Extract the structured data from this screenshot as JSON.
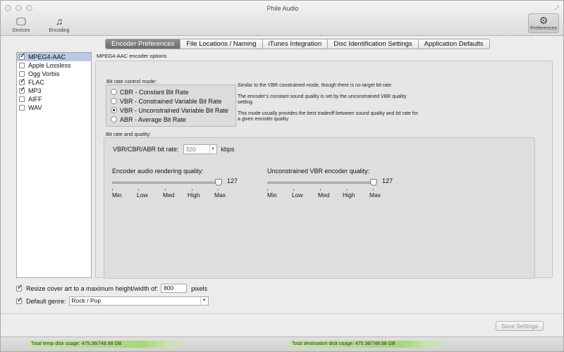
{
  "window": {
    "title": "Phile Audio"
  },
  "toolbar": {
    "devices_label": "Devices",
    "encoding_label": "Encoding",
    "preferences_label": "Preferences"
  },
  "tabs": [
    {
      "label": "Encoder Preferences",
      "active": true
    },
    {
      "label": "File Locations / Naming",
      "active": false
    },
    {
      "label": "iTunes Integration",
      "active": false
    },
    {
      "label": "Disc Identification Settings",
      "active": false
    },
    {
      "label": "Application Defaults",
      "active": false
    }
  ],
  "encoders": [
    {
      "label": "MPEG4-AAC",
      "checked": true,
      "selected": true
    },
    {
      "label": "Apple Lossless",
      "checked": false,
      "selected": false
    },
    {
      "label": "Ogg Vorbis",
      "checked": false,
      "selected": false
    },
    {
      "label": "FLAC",
      "checked": true,
      "selected": false
    },
    {
      "label": "MP3",
      "checked": true,
      "selected": false
    },
    {
      "label": "AIFF",
      "checked": false,
      "selected": false
    },
    {
      "label": "WAV",
      "checked": false,
      "selected": false
    }
  ],
  "panel": {
    "title": "MPEG4-AAC encoder options",
    "bitrate_mode_label": "Bit rate control mode:",
    "modes": [
      {
        "label": "CBR - Constant Bit Rate",
        "selected": false
      },
      {
        "label": "VBR - Constrained Variable Bit Rate",
        "selected": false
      },
      {
        "label": "VBR - Unconstrained Variable Bit Rate",
        "selected": true
      },
      {
        "label": "ABR - Average Bit Rate",
        "selected": false
      }
    ],
    "description": [
      "Similar to the VBR constrained mode, though there is no target bit rate.",
      "The encoder's constant sound quality is set by the unconstrained VBR quality setting.",
      "This mode usually provides the best tradeoff between sound quality and bit rate for a given encoder quality."
    ],
    "quality_label": "Bit rate and quality:",
    "bitrate_label": "VBR/CBR/ABR bit rate:",
    "bitrate_value": "320",
    "bitrate_unit": "kbps",
    "sliders": [
      {
        "title": "Encoder audio rendering quality:",
        "value": "127",
        "fraction": 1.0
      },
      {
        "title": "Unconstrained VBR encoder quality:",
        "value": "127",
        "fraction": 1.0
      }
    ],
    "tick_labels": [
      "Min",
      "Low",
      "Med",
      "High",
      "Max"
    ]
  },
  "options": {
    "resize_label": "Resize cover art to a maximum height/width of:",
    "resize_checked": true,
    "resize_value": "800",
    "resize_unit": "pixels",
    "genre_label": "Default genre:",
    "genre_checked": true,
    "genre_value": "Rock / Pop"
  },
  "buttons": {
    "save_label": "Save Settings"
  },
  "status": {
    "temp_disk": "Total temp disk usage: 475.36/748.98 GB",
    "dest_disk": "Total destination disk usage: 475.36/748.98 GB"
  },
  "colors": {
    "selection": "#b8c9e6",
    "active_tab": "#7d7d7d",
    "disk_bar": "#a7d67a"
  }
}
